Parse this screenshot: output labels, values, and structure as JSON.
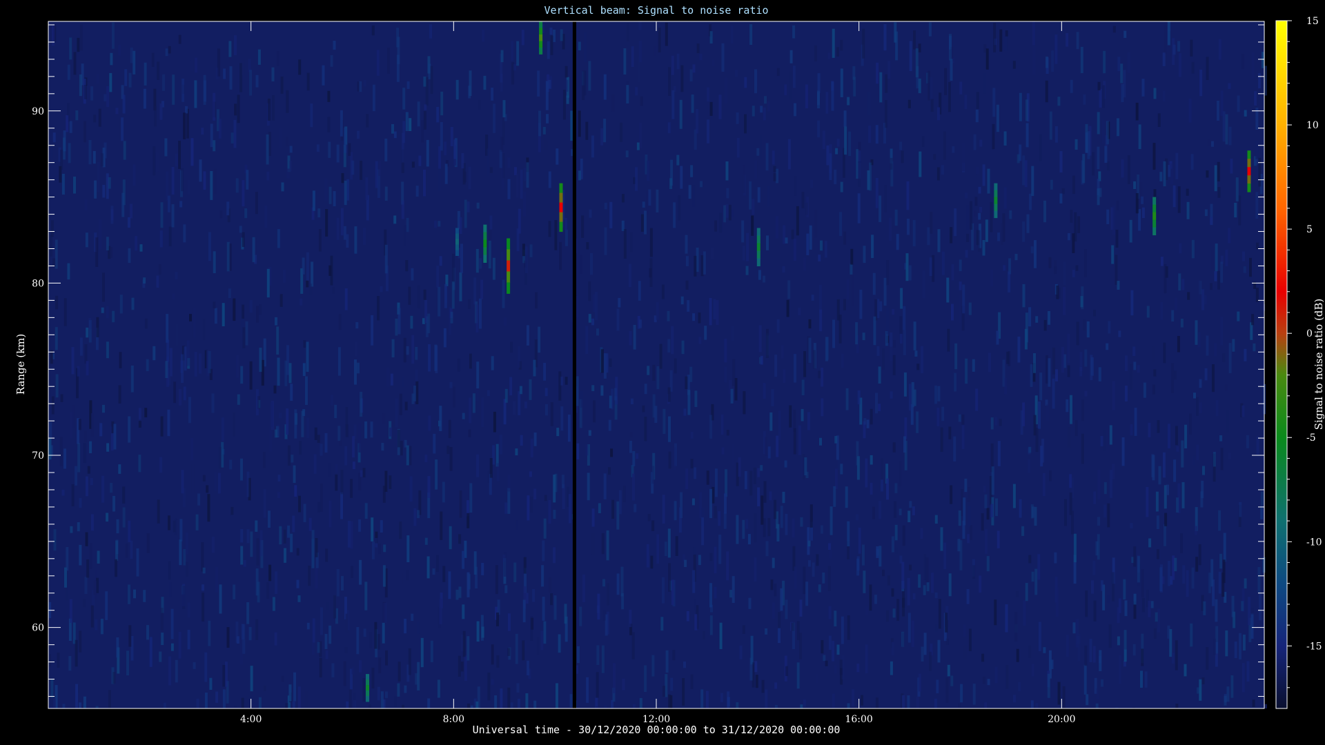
{
  "chart_data": {
    "type": "heatmap",
    "title": "Vertical beam: Signal to noise ratio",
    "xlabel": "Universal time - 30/12/2020 00:00:00 to 31/12/2020 00:00:00",
    "ylabel": "Range (km)",
    "x_unit": "hours UT",
    "xlim": [
      0,
      24
    ],
    "ylim": [
      55.3,
      95.2
    ],
    "x_ticks": [
      {
        "value": 4,
        "label": "4:00"
      },
      {
        "value": 8,
        "label": "8:00"
      },
      {
        "value": 12,
        "label": "12:00"
      },
      {
        "value": 16,
        "label": "16:00"
      },
      {
        "value": 20,
        "label": "20:00"
      }
    ],
    "y_ticks": [
      {
        "value": 60,
        "label": "60"
      },
      {
        "value": 70,
        "label": "70"
      },
      {
        "value": 80,
        "label": "80"
      },
      {
        "value": 90,
        "label": "90"
      }
    ],
    "background_level_db": -16,
    "data_gap": {
      "x_start": 10.35,
      "x_end": 10.42
    },
    "echoes": [
      {
        "x": 6.3,
        "y_range": [
          55.7,
          57.3
        ],
        "peak_db": -6
      },
      {
        "x": 8.07,
        "y_range": [
          81.6,
          83.2
        ],
        "peak_db": -10
      },
      {
        "x": 8.62,
        "y_range": [
          81.2,
          83.4
        ],
        "peak_db": -5
      },
      {
        "x": 9.08,
        "y_range": [
          79.4,
          82.6
        ],
        "peak_db": 1
      },
      {
        "x": 9.72,
        "y_range": [
          93.3,
          95.2
        ],
        "peak_db": -2
      },
      {
        "x": 10.12,
        "y_range": [
          83.0,
          85.8
        ],
        "peak_db": 2
      },
      {
        "x": 14.02,
        "y_range": [
          81.0,
          83.2
        ],
        "peak_db": -6
      },
      {
        "x": 18.7,
        "y_range": [
          83.8,
          85.8
        ],
        "peak_db": -6
      },
      {
        "x": 21.83,
        "y_range": [
          82.8,
          85.0
        ],
        "peak_db": -4
      },
      {
        "x": 23.7,
        "y_range": [
          85.3,
          87.7
        ],
        "peak_db": 2
      }
    ],
    "colorbar": {
      "label": "Signal to noise ratio (dB)",
      "range": [
        -18,
        15
      ],
      "ticks": [
        {
          "value": -15,
          "label": "-15"
        },
        {
          "value": -10,
          "label": "-10"
        },
        {
          "value": -5,
          "label": "-5"
        },
        {
          "value": 0,
          "label": "0"
        },
        {
          "value": 5,
          "label": "5"
        },
        {
          "value": 10,
          "label": "10"
        },
        {
          "value": 15,
          "label": "15"
        }
      ],
      "colormap": [
        {
          "value": -18,
          "color": "#0a1030"
        },
        {
          "value": -15,
          "color": "#16257a"
        },
        {
          "value": -12,
          "color": "#0e4a82"
        },
        {
          "value": -9,
          "color": "#0f7070"
        },
        {
          "value": -5,
          "color": "#0a8a1c"
        },
        {
          "value": -2,
          "color": "#4a8a10"
        },
        {
          "value": 0,
          "color": "#b84010"
        },
        {
          "value": 2,
          "color": "#e80000"
        },
        {
          "value": 6,
          "color": "#ff6600"
        },
        {
          "value": 10,
          "color": "#ffb000"
        },
        {
          "value": 15,
          "color": "#ffff00"
        }
      ]
    }
  }
}
